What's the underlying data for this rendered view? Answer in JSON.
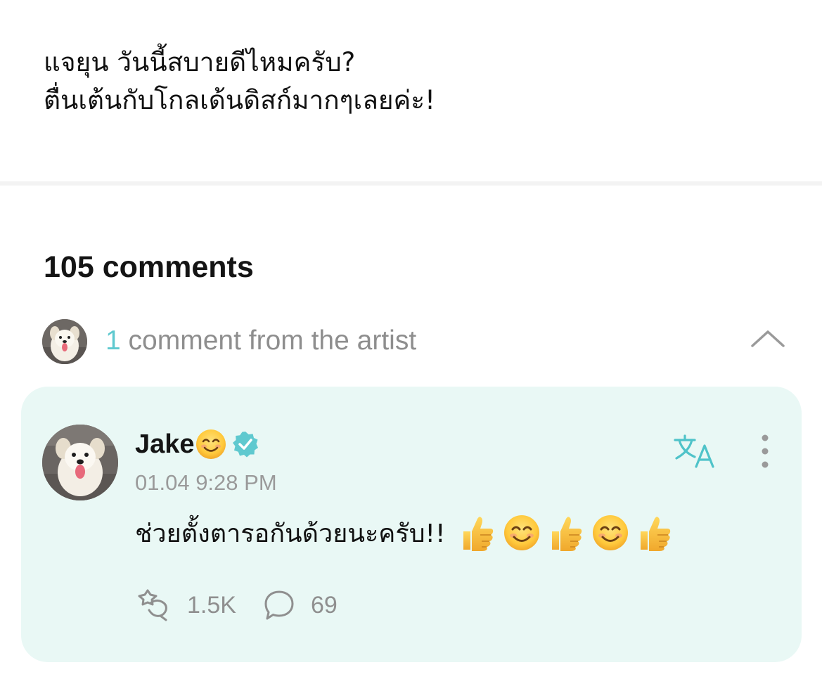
{
  "post": {
    "lines": [
      "แจยุน วันนี้สบายดีไหมครับ?",
      "ตื่นเต้นกับโกลเด้นดิสก์มากๆเลยค่ะ!"
    ]
  },
  "comments_section": {
    "count_label": "105 comments",
    "artist_bar": {
      "count": "1",
      "label": " comment from the artist",
      "collapse_icon": "chevron-up-icon"
    }
  },
  "artist_comment": {
    "author": "Jake",
    "author_emoji": "smiling-face-emoji",
    "verified_icon": "verified-badge-icon",
    "timestamp": "01.04 9:28 PM",
    "text": "ช่วยตั้งตารอกันด้วยนะครับ!!",
    "emojis": [
      "thumbs-up",
      "smiling-face",
      "thumbs-up",
      "smiling-face",
      "thumbs-up"
    ],
    "translate_icon": "translate-icon",
    "more_icon": "more-vertical-icon",
    "likes": "1.5K",
    "replies": "69"
  },
  "colors": {
    "accent": "#5fc9cf",
    "card_background": "#e9f8f5",
    "muted_text": "#8e8e8e"
  }
}
